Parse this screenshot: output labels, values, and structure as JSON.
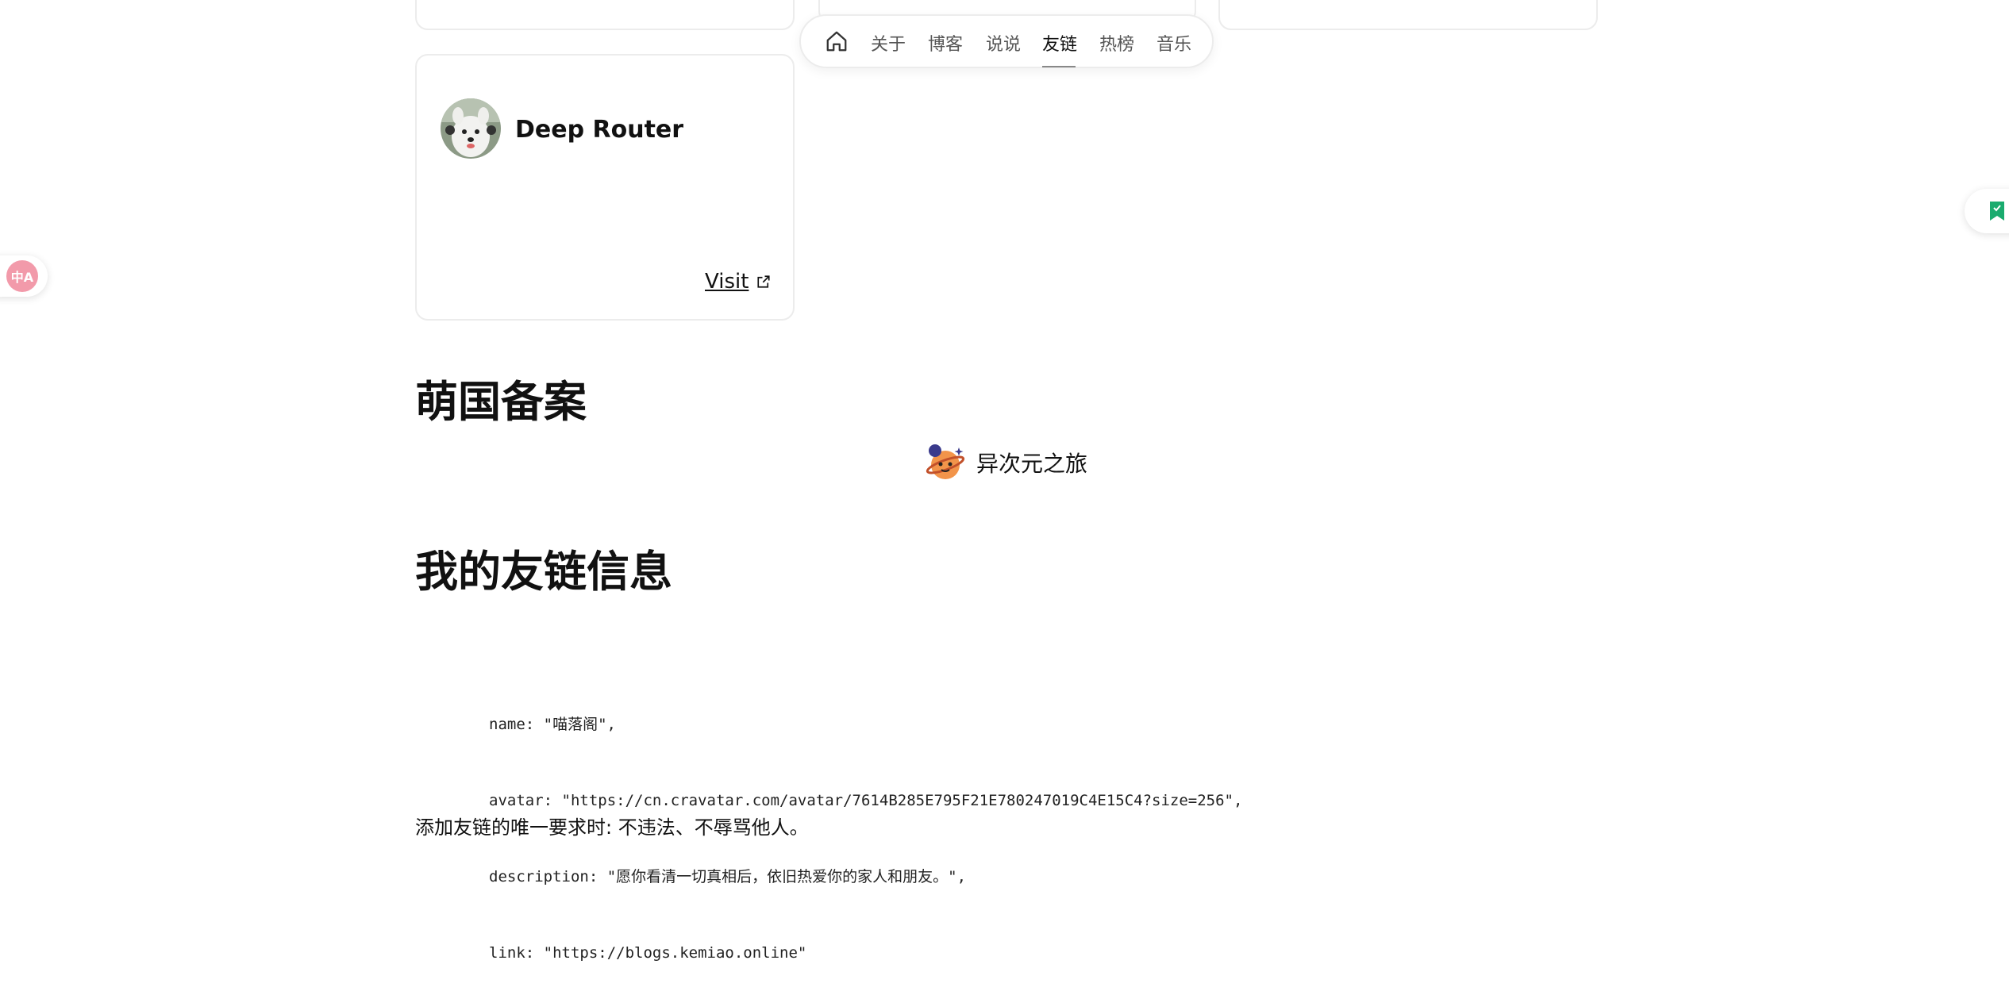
{
  "nav": {
    "items": [
      {
        "label": "关于"
      },
      {
        "label": "博客"
      },
      {
        "label": "说说"
      },
      {
        "label": "友链",
        "active": true
      },
      {
        "label": "热榜"
      },
      {
        "label": "音乐"
      }
    ],
    "home_icon": "home-icon"
  },
  "friend": {
    "name": "Deep Router",
    "visit_label": "Visit",
    "visit_icon": "external-link-icon",
    "avatar_icon": "dog-avatar"
  },
  "sections": {
    "moe_title": "萌国备案",
    "info_title": "我的友链信息"
  },
  "moe_badge": {
    "icon": "planet-mascot-icon",
    "text": "异次元之旅"
  },
  "code_lines": [
    "name: \"喵落阁\",",
    "avatar: \"https://cn.cravatar.com/avatar/7614B285E795F21E780247019C4E15C4?size=256\",",
    "description: \"愿你看清一切真相后，依旧热爱你的家人和朋友。\",",
    "link: \"https://blogs.kemiao.online\""
  ],
  "note": "添加友链的唯一要求时: 不违法、不辱骂他人。",
  "floating": {
    "translate_label": "中A",
    "bookmark_color": "#1aab6e",
    "translate_color": "#f29aaa"
  }
}
